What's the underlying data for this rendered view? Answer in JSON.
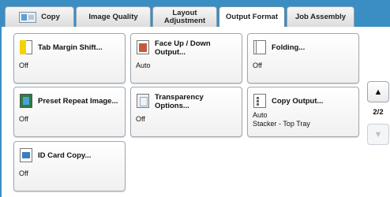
{
  "tabs": [
    {
      "label": "Copy"
    },
    {
      "label": "Image Quality"
    },
    {
      "label": "Layout\nAdjustment"
    },
    {
      "label": "Output Format"
    },
    {
      "label": "Job Assembly"
    }
  ],
  "active_tab": "Output Format",
  "icons": [
    "copy-tab-icon",
    "tab-margin-icon",
    "face-up-down-icon",
    "folding-icon",
    "preset-repeat-icon",
    "transparency-icon",
    "copy-output-icon",
    "id-card-icon",
    "arrow-up-icon",
    "arrow-down-icon"
  ],
  "buttons": {
    "tab_margin": {
      "label": "Tab Margin Shift...",
      "value": "Off"
    },
    "face_up": {
      "label": "Face Up / Down\nOutput...",
      "value": "Auto"
    },
    "folding": {
      "label": "Folding...",
      "value": "Off"
    },
    "preset_repeat": {
      "label": "Preset Repeat Image...",
      "value": "Off"
    },
    "transparency": {
      "label": "Transparency\nOptions...",
      "value": "Off"
    },
    "copy_output": {
      "label": "Copy Output...",
      "value": "Auto",
      "value2": "Stacker - Top Tray"
    },
    "id_card": {
      "label": "ID Card Copy...",
      "value": "Off"
    }
  },
  "pager": {
    "up": "▲",
    "page": "2/2",
    "down": "▼"
  },
  "colors": {
    "tab_bar": "#3a8ec3",
    "disabled": "#b8c4cc"
  }
}
